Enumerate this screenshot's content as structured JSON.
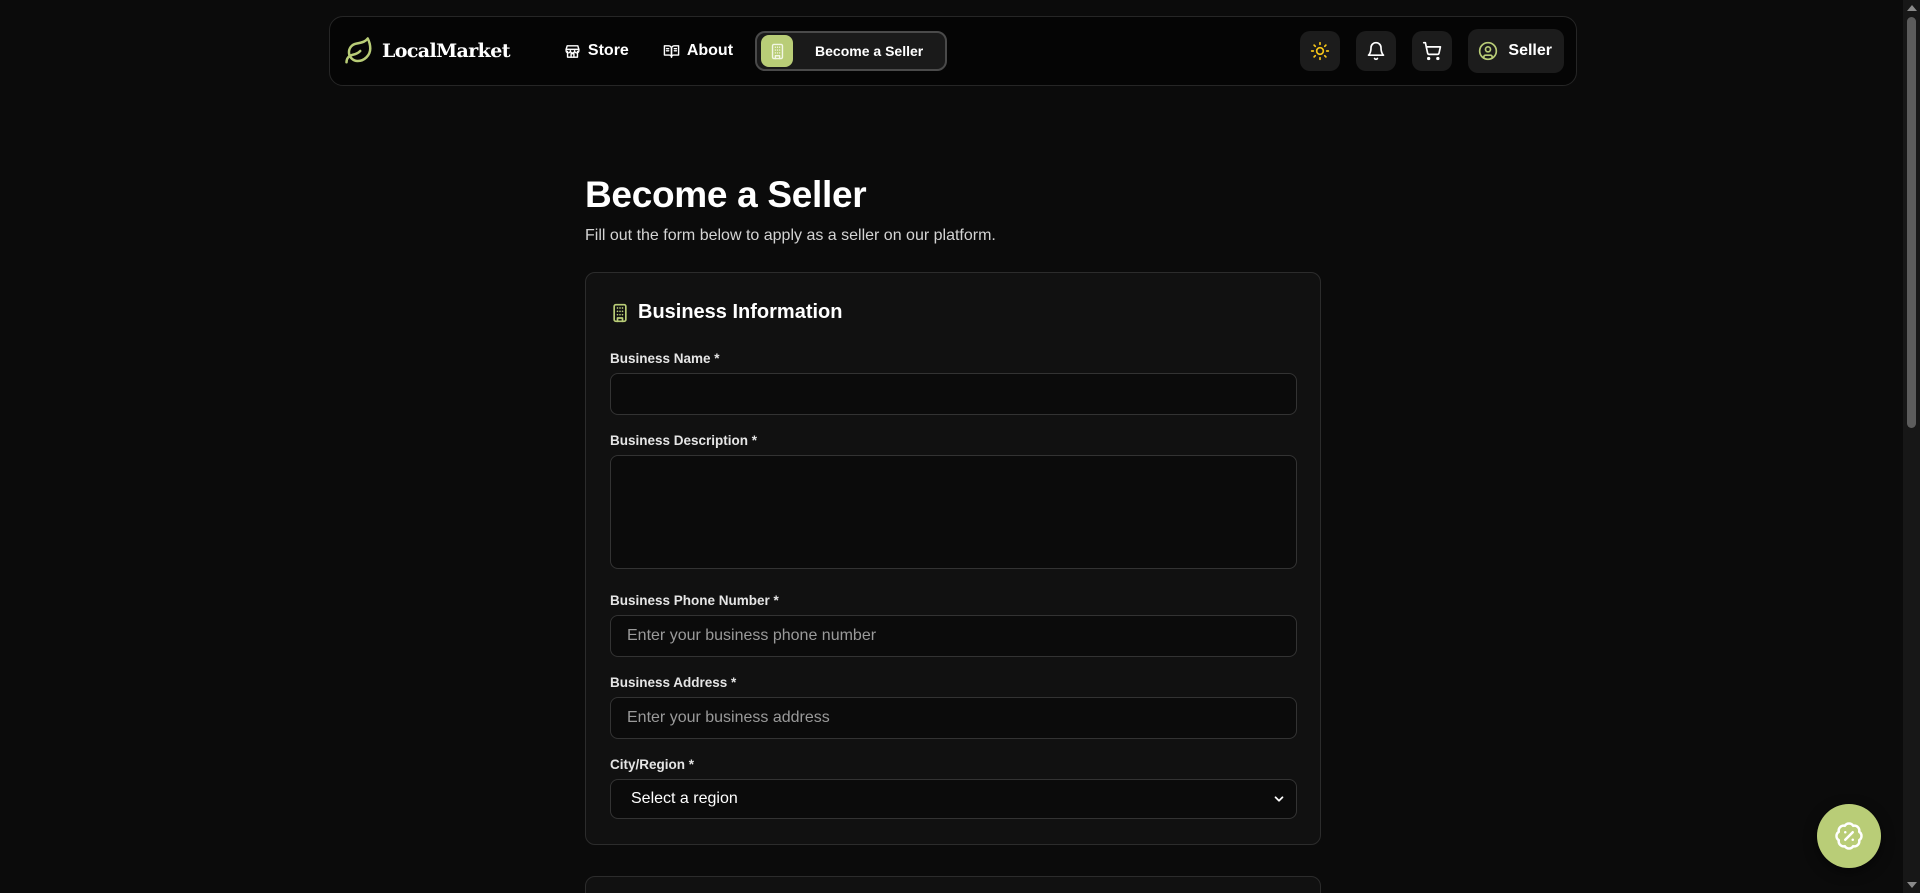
{
  "nav": {
    "brand": "LocalMarket",
    "links": [
      {
        "label": "Store",
        "icon": "store-icon"
      },
      {
        "label": "About",
        "icon": "book-open-icon"
      }
    ],
    "become_seller_label": "Become a Seller",
    "user_label": "Seller"
  },
  "page": {
    "title": "Become a Seller",
    "subtitle": "Fill out the form below to apply as a seller on our platform."
  },
  "form": {
    "section_title": "Business Information",
    "business_name": {
      "label": "Business Name *",
      "placeholder": ""
    },
    "business_description": {
      "label": "Business Description *",
      "placeholder": ""
    },
    "business_phone": {
      "label": "Business Phone Number *",
      "placeholder": "Enter your business phone number"
    },
    "business_address": {
      "label": "Business Address *",
      "placeholder": "Enter your business address"
    },
    "city_region": {
      "label": "City/Region *",
      "selected": "Select a region"
    }
  },
  "colors": {
    "accent": "#b9cd77",
    "sun": "#f5c518",
    "background": "#0b0b0b",
    "card": "#111111"
  }
}
